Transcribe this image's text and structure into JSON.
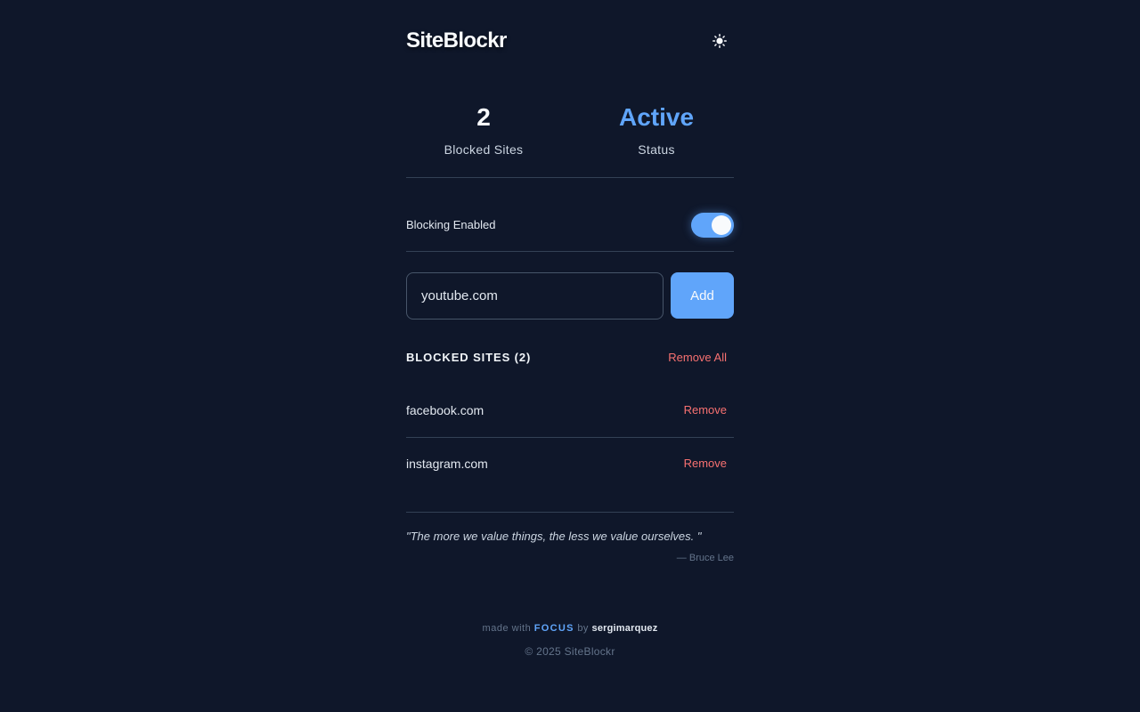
{
  "header": {
    "title": "SiteBlockr",
    "theme_icon": "sun-icon"
  },
  "stats": {
    "blocked_count": "2",
    "blocked_label": "Blocked Sites",
    "status_value": "Active",
    "status_label": "Status"
  },
  "blocking": {
    "label": "Blocking Enabled",
    "enabled": true
  },
  "add_site": {
    "input_value": "youtube.com",
    "button_label": "Add"
  },
  "blocked_list": {
    "title": "BLOCKED SITES (2)",
    "remove_all_label": "Remove All",
    "items": [
      {
        "site": "facebook.com",
        "remove_label": "Remove"
      },
      {
        "site": "instagram.com",
        "remove_label": "Remove"
      }
    ]
  },
  "quote": {
    "text": "\"The more we value things, the less we value ourselves. \"",
    "author": "— Bruce Lee"
  },
  "footer": {
    "made_with": "made with",
    "brand": "FOCUS",
    "by": "by",
    "author": "sergimarquez",
    "copyright": "© 2025 SiteBlockr"
  },
  "colors": {
    "background": "#0f172a",
    "accent": "#60a5fa",
    "danger": "#f87171",
    "border": "#334155"
  }
}
